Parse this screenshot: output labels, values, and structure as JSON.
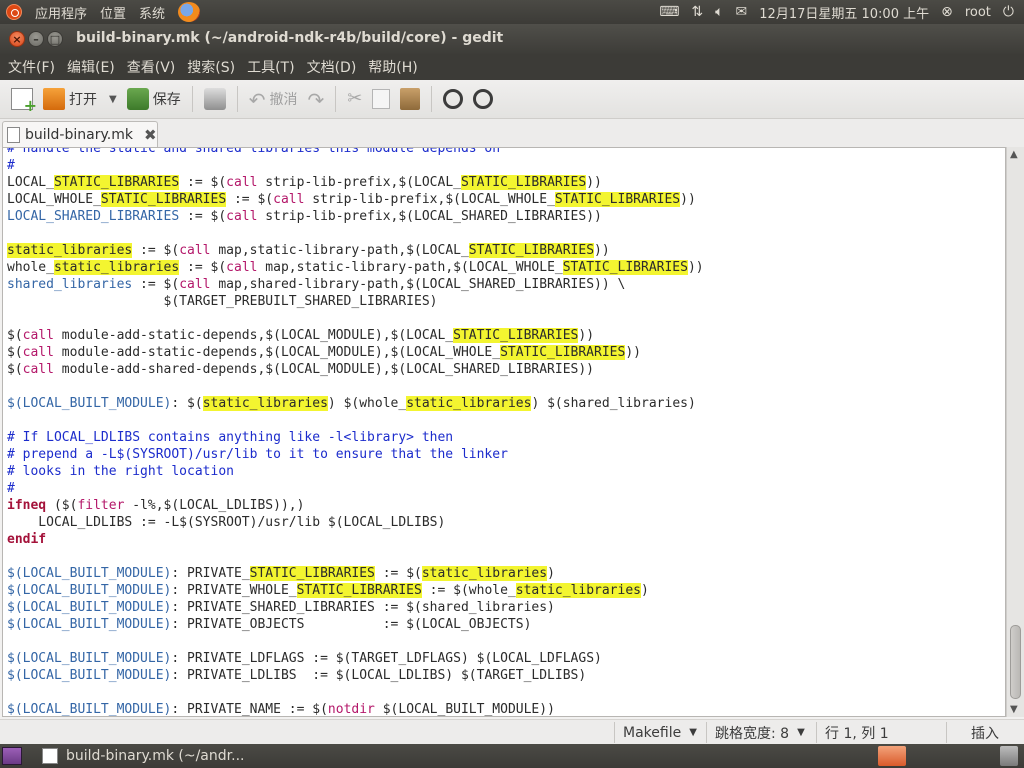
{
  "top_panel": {
    "apps": "应用程序",
    "places": "位置",
    "system": "系统",
    "datetime": "12月17日星期五 10:00 上午",
    "user": "root",
    "icons": [
      "ubuntu-logo-icon",
      "firefox-icon",
      "keyboard-icon",
      "network-icon",
      "volume-icon",
      "mail-icon",
      "user-icon",
      "power-icon"
    ]
  },
  "window": {
    "title": "build-binary.mk (~/android-ndk-r4b/build/core) - gedit"
  },
  "menu": {
    "file": "文件(F)",
    "edit": "编辑(E)",
    "view": "查看(V)",
    "search": "搜索(S)",
    "tools": "工具(T)",
    "documents": "文档(D)",
    "help": "帮助(H)"
  },
  "toolbar": {
    "open": "打开",
    "save": "保存",
    "undo": "撤消"
  },
  "tab": {
    "name": "build-binary.mk"
  },
  "code": {
    "lines": [
      "# handle the static and shared libraries this module depends on",
      "#",
      "LOCAL_STATIC_LIBRARIES := $(call strip-lib-prefix,$(LOCAL_STATIC_LIBRARIES))",
      "LOCAL_WHOLE_STATIC_LIBRARIES := $(call strip-lib-prefix,$(LOCAL_WHOLE_STATIC_LIBRARIES))",
      "LOCAL_SHARED_LIBRARIES := $(call strip-lib-prefix,$(LOCAL_SHARED_LIBRARIES))",
      "",
      "static_libraries := $(call map,static-library-path,$(LOCAL_STATIC_LIBRARIES))",
      "whole_static_libraries := $(call map,static-library-path,$(LOCAL_WHOLE_STATIC_LIBRARIES))",
      "shared_libraries := $(call map,shared-library-path,$(LOCAL_SHARED_LIBRARIES)) \\",
      "                    $(TARGET_PREBUILT_SHARED_LIBRARIES)",
      "",
      "$(call module-add-static-depends,$(LOCAL_MODULE),$(LOCAL_STATIC_LIBRARIES))",
      "$(call module-add-static-depends,$(LOCAL_MODULE),$(LOCAL_WHOLE_STATIC_LIBRARIES))",
      "$(call module-add-shared-depends,$(LOCAL_MODULE),$(LOCAL_SHARED_LIBRARIES))",
      "",
      "$(LOCAL_BUILT_MODULE): $(static_libraries) $(whole_static_libraries) $(shared_libraries)",
      "",
      "# If LOCAL_LDLIBS contains anything like -l<library> then",
      "# prepend a -L$(SYSROOT)/usr/lib to it to ensure that the linker",
      "# looks in the right location",
      "#",
      "ifneq ($(filter -l%,$(LOCAL_LDLIBS)),)",
      "    LOCAL_LDLIBS := -L$(SYSROOT)/usr/lib $(LOCAL_LDLIBS)",
      "endif",
      "",
      "$(LOCAL_BUILT_MODULE): PRIVATE_STATIC_LIBRARIES := $(static_libraries)",
      "$(LOCAL_BUILT_MODULE): PRIVATE_WHOLE_STATIC_LIBRARIES := $(whole_static_libraries)",
      "$(LOCAL_BUILT_MODULE): PRIVATE_SHARED_LIBRARIES := $(shared_libraries)",
      "$(LOCAL_BUILT_MODULE): PRIVATE_OBJECTS          := $(LOCAL_OBJECTS)",
      "",
      "$(LOCAL_BUILT_MODULE): PRIVATE_LDFLAGS := $(TARGET_LDFLAGS) $(LOCAL_LDFLAGS)",
      "$(LOCAL_BUILT_MODULE): PRIVATE_LDLIBS  := $(LOCAL_LDLIBS) $(TARGET_LDLIBS)",
      "",
      "$(LOCAL_BUILT_MODULE): PRIVATE_NAME := $(notdir $(LOCAL_BUILT_MODULE))"
    ]
  },
  "status": {
    "language": "Makefile",
    "tab_width": "跳格宽度: 8",
    "position": "行 1, 列 1",
    "mode": "插入"
  },
  "taskbar": {
    "task": "build-binary.mk (~/andr..."
  },
  "colors": {
    "search_highlight": "#f3f530",
    "panel_bg": "#3c3b37",
    "close_button": "#df4a16"
  }
}
